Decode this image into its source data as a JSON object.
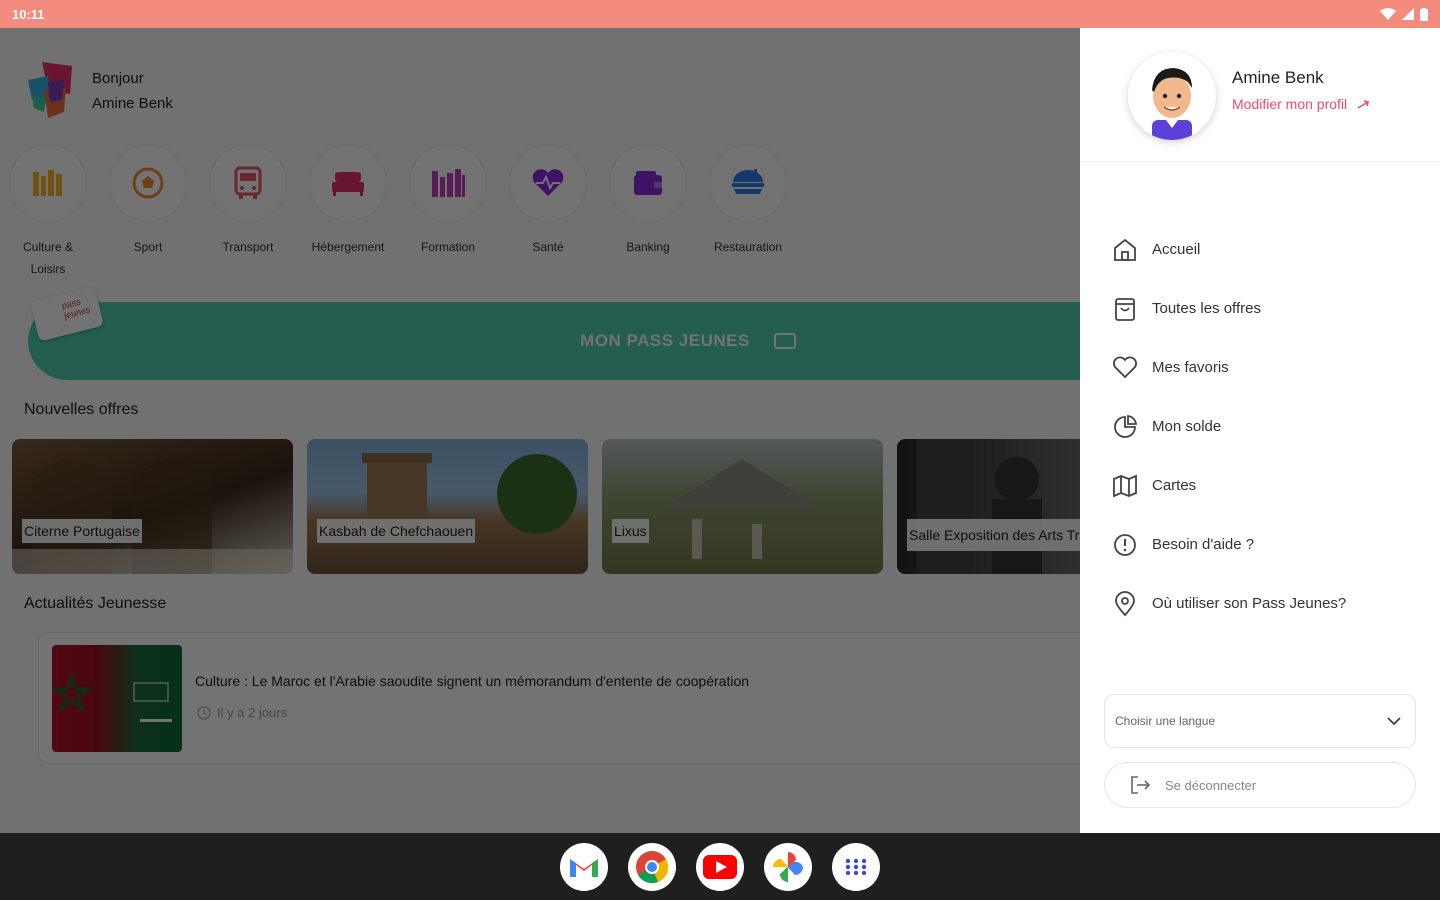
{
  "status_bar": {
    "time": "10:11"
  },
  "user": {
    "greeting": "Bonjour",
    "name": "Amine Benk"
  },
  "categories": [
    {
      "label": "Culture & Loisirs",
      "icon": "books-icon"
    },
    {
      "label": "Sport",
      "icon": "soccer-ball-icon"
    },
    {
      "label": "Transport",
      "icon": "bus-icon"
    },
    {
      "label": "Hébergement",
      "icon": "bed-icon"
    },
    {
      "label": "Formation",
      "icon": "library-icon"
    },
    {
      "label": "Santé",
      "icon": "heart-pulse-icon"
    },
    {
      "label": "Banking",
      "icon": "wallet-icon"
    },
    {
      "label": "Restauration",
      "icon": "food-icon"
    }
  ],
  "pass": {
    "label": "MON PASS JEUNES",
    "card_text": "pass jeunes"
  },
  "offers_section": {
    "title": "Nouvelles offres"
  },
  "offers": [
    {
      "label": "Citerne Portugaise"
    },
    {
      "label": "Kasbah de Chefchaouen"
    },
    {
      "label": "Lixus"
    },
    {
      "label": "Salle Exposition des Arts Traditionnels"
    }
  ],
  "news_section": {
    "title": "Actualités Jeunesse"
  },
  "news": [
    {
      "title": "Culture : Le Maroc et l'Arabie saoudite signent un mémorandum d'entente de coopération",
      "time": "Il y a 2 jours"
    }
  ],
  "drawer": {
    "name": "Amine Benk",
    "edit_profile": "Modifier mon profil",
    "menu": [
      {
        "label": "Accueil",
        "icon": "home-icon"
      },
      {
        "label": "Toutes les offres",
        "icon": "shopping-bag-icon"
      },
      {
        "label": "Mes favoris",
        "icon": "heart-icon"
      },
      {
        "label": "Mon solde",
        "icon": "pie-chart-icon"
      },
      {
        "label": "Cartes",
        "icon": "map-icon"
      },
      {
        "label": "Besoin d'aide ?",
        "icon": "alert-circle-icon"
      },
      {
        "label": "Où utiliser son Pass Jeunes?",
        "icon": "location-pin-icon"
      }
    ],
    "language_placeholder": "Choisir une langue",
    "logout": "Se déconnecter"
  },
  "taskbar": [
    "gmail-icon",
    "chrome-icon",
    "youtube-icon",
    "photos-icon",
    "apps-grid-icon"
  ],
  "colors": {
    "status_bar": "#f48b7f",
    "accent_pink": "#ef4b6c",
    "pass_green": "#4ed1b3",
    "category_purple": "#8a2be2"
  }
}
